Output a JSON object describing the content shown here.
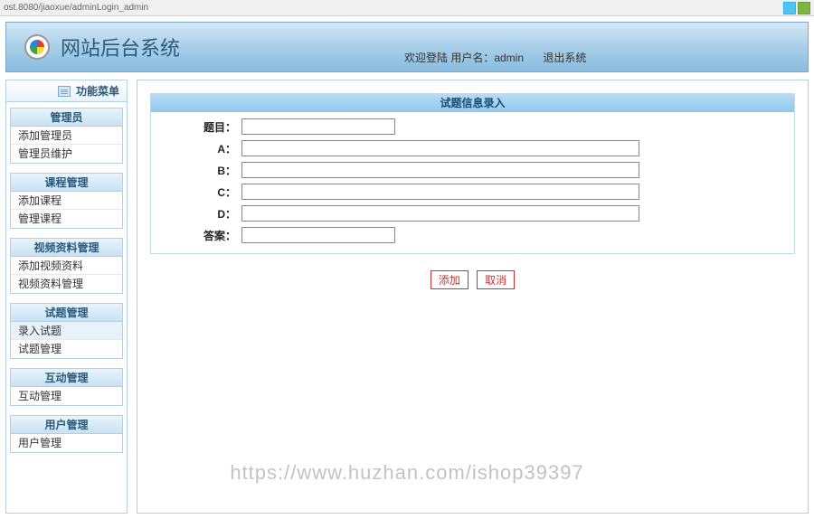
{
  "browser": {
    "address": "ost.8080/jiaoxue/adminLogin_admin"
  },
  "header": {
    "title": "网站后台系统",
    "welcome": "欢迎登陆 用户名：admin",
    "logout": "退出系统"
  },
  "sidebar": {
    "menuHeader": "功能菜单",
    "groups": [
      {
        "title": "管理员",
        "items": [
          "添加管理员",
          "管理员维护"
        ]
      },
      {
        "title": "课程管理",
        "items": [
          "添加课程",
          "管理课程"
        ]
      },
      {
        "title": "视频资料管理",
        "items": [
          "添加视频资料",
          "视频资料管理"
        ]
      },
      {
        "title": "试题管理",
        "items": [
          "录入试题",
          "试题管理"
        ]
      },
      {
        "title": "互动管理",
        "items": [
          "互动管理"
        ]
      },
      {
        "title": "用户管理",
        "items": [
          "用户管理"
        ]
      }
    ]
  },
  "form": {
    "title": "试题信息录入",
    "labels": {
      "question": "题目：",
      "a": "A：",
      "b": "B：",
      "c": "C：",
      "d": "D：",
      "answer": "答案："
    },
    "buttons": {
      "add": "添加",
      "cancel": "取消"
    }
  },
  "watermark": "https://www.huzhan.com/ishop39397"
}
